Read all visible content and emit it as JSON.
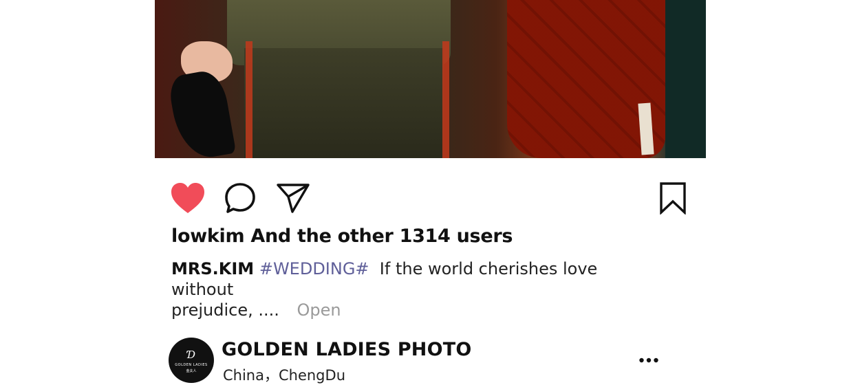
{
  "post": {
    "likes_text": "lowkim And the other 1314 users",
    "caption": {
      "username": "MRS.KIM",
      "hashtag": "#WEDDING#",
      "text_line1": "If the world cherishes love without",
      "text_line2": "prejudice, ....",
      "open_label": "Open"
    }
  },
  "account": {
    "name": "GOLDEN LADIES PHOTO",
    "location": "China，ChengDu",
    "avatar_monogram": "Ɗ",
    "avatar_brand": "GOLDEN LADIES",
    "avatar_brand_sub": "金夫人"
  },
  "icons": {
    "like": "heart-icon",
    "comment": "comment-icon",
    "share": "send-icon",
    "save": "bookmark-icon",
    "more": "more-icon"
  },
  "colors": {
    "like_active": "#f14c59",
    "hashtag": "#5f5f99",
    "open_link": "#9a9a9a"
  }
}
